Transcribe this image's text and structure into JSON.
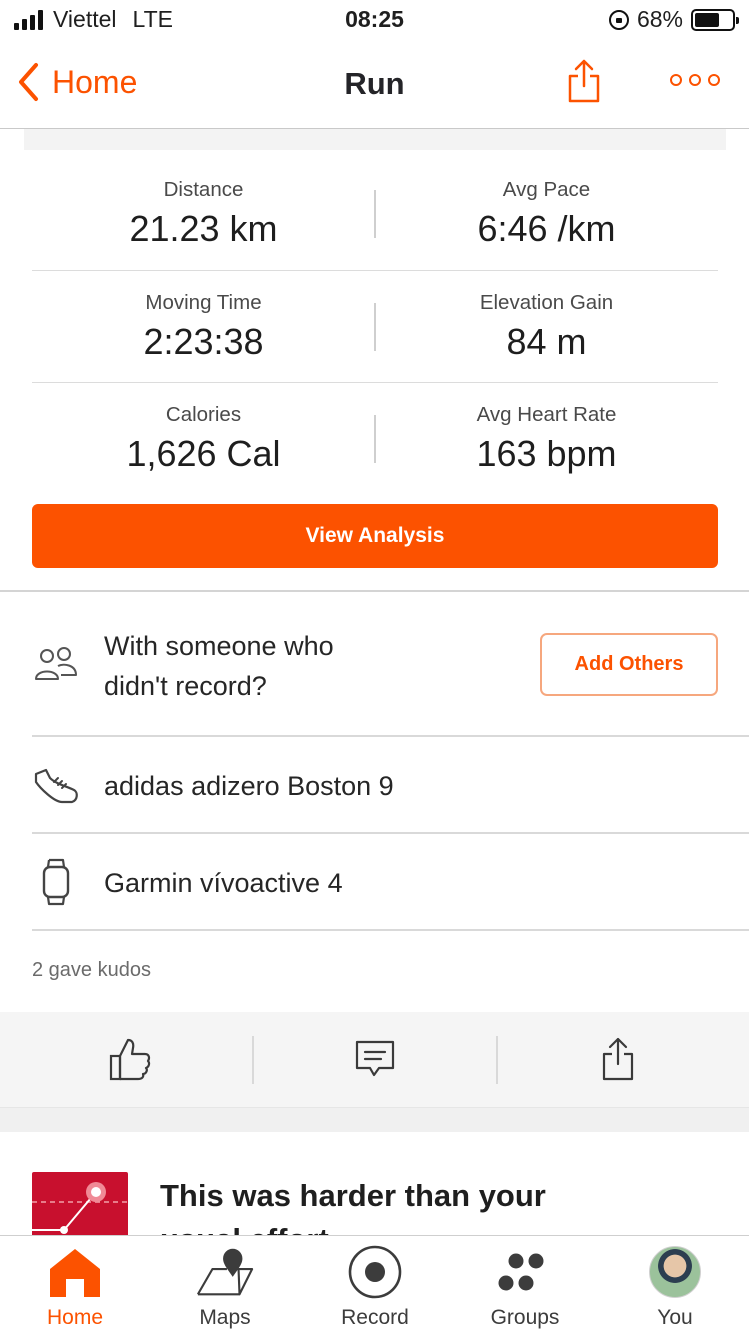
{
  "status_bar": {
    "carrier": "Viettel",
    "network": "LTE",
    "time": "08:25",
    "battery": "68%",
    "battery_level": 0.68
  },
  "nav": {
    "back_label": "Home",
    "title": "Run"
  },
  "stats": [
    {
      "label": "Distance",
      "value": "21.23 km"
    },
    {
      "label": "Avg Pace",
      "value": "6:46 /km"
    },
    {
      "label": "Moving Time",
      "value": "2:23:38"
    },
    {
      "label": "Elevation Gain",
      "value": "84 m"
    },
    {
      "label": "Calories",
      "value": "1,626 Cal"
    },
    {
      "label": "Avg Heart Rate",
      "value": "163 bpm"
    }
  ],
  "analysis_button": "View Analysis",
  "with_others": {
    "line1": "With someone who",
    "line2": "didn't record?",
    "button": "Add Others"
  },
  "gear": {
    "shoes": "adidas adizero Boston 9",
    "device": "Garmin vívoactive 4"
  },
  "kudos": "2 gave kudos",
  "insight": {
    "title_line1": "This was harder than your",
    "title_line2": "usual effort"
  },
  "tabs": [
    {
      "label": "Home",
      "icon": "home-icon",
      "active": true
    },
    {
      "label": "Maps",
      "icon": "map-icon",
      "active": false
    },
    {
      "label": "Record",
      "icon": "record-icon",
      "active": false
    },
    {
      "label": "Groups",
      "icon": "groups-icon",
      "active": false
    },
    {
      "label": "You",
      "icon": "avatar",
      "active": false
    }
  ],
  "colors": {
    "accent": "#fc5200",
    "text": "#1f1f1f",
    "muted": "#6b6b6b",
    "divider": "#d9d9d9"
  }
}
